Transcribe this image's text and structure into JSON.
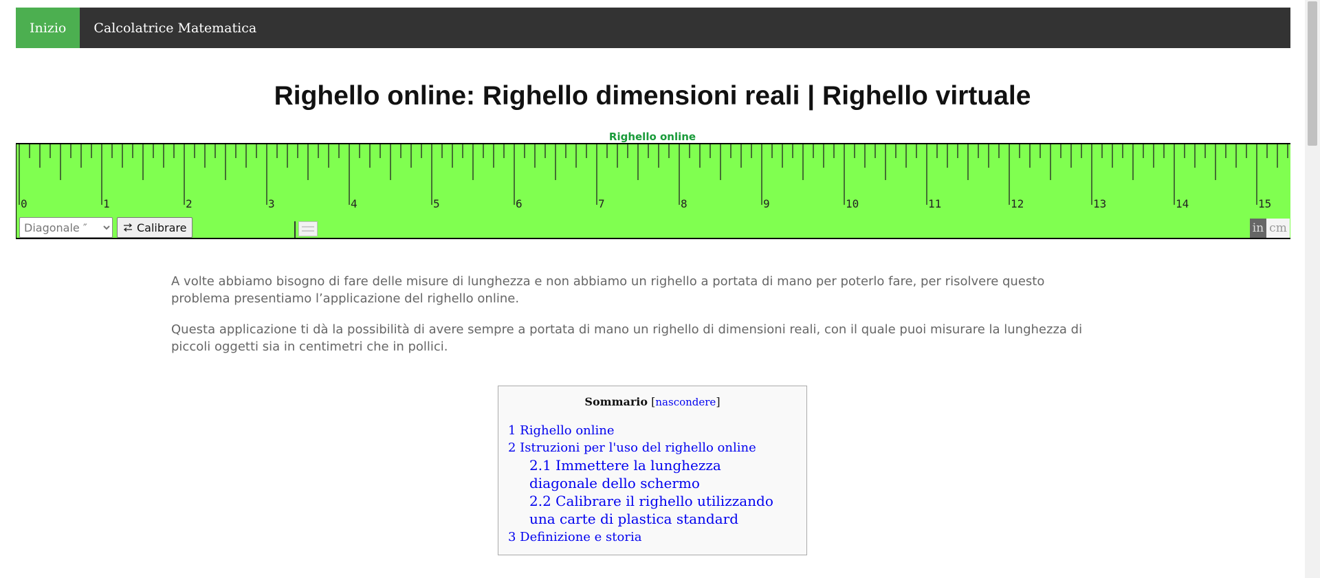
{
  "nav": {
    "items": [
      {
        "label": "Inizio",
        "active": true
      },
      {
        "label": "Calcolatrice Matematica",
        "active": false
      }
    ],
    "bg_color": "#333333",
    "active_color": "#4caf50"
  },
  "page_title": "Righello online: Righello dimensioni reali | Righello virtuale",
  "ruler": {
    "caption": "Righello online",
    "bg_color": "#80ff50",
    "numbers": [
      "0",
      "1",
      "2",
      "3",
      "4",
      "5",
      "6",
      "7",
      "8",
      "9",
      "10",
      "11",
      "12",
      "13",
      "14",
      "15"
    ],
    "subdivisions_per_unit": 8,
    "diagonal_select": {
      "selected": "Diagonale ″"
    },
    "calibrate_label": "Calibrare",
    "unit_in": "in",
    "unit_cm": "cm",
    "active_unit": "in"
  },
  "intro": {
    "p1": "A volte abbiamo bisogno di fare delle misure di lunghezza e non abbiamo un righello a portata di mano per poterlo fare, per risolvere questo problema presentiamo l’applicazione del righello online.",
    "p2": "Questa applicazione ti dà la possibilità di avere sempre a portata di mano un righello di dimensioni reali, con il quale puoi misurare la lunghezza di piccoli oggetti sia in centimetri che in pollici."
  },
  "toc": {
    "title": "Sommario",
    "toggle": "nascondere",
    "items": [
      "1 Righello online",
      "2 Istruzioni per l'uso del righello online",
      "2.1 Immettere la lunghezza diagonale dello schermo",
      "2.2 Calibrare il righello utilizzando una carte di plastica standard",
      "3 Definizione e storia"
    ]
  }
}
